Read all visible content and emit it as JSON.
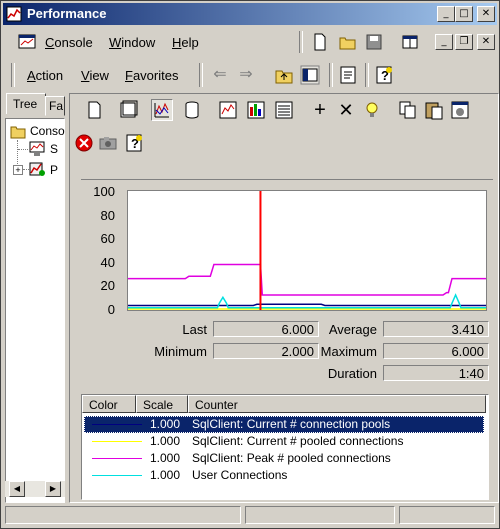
{
  "window": {
    "title": "Performance"
  },
  "menubar": {
    "items": [
      {
        "pre": "",
        "key": "C",
        "post": "onsole"
      },
      {
        "pre": "",
        "key": "W",
        "post": "indow"
      },
      {
        "pre": "",
        "key": "H",
        "post": "elp"
      }
    ]
  },
  "actionbar": {
    "items": [
      {
        "pre": "",
        "key": "A",
        "post": "ction"
      },
      {
        "pre": "",
        "key": "V",
        "post": "iew"
      },
      {
        "pre": "",
        "key": "F",
        "post": "avorites"
      }
    ]
  },
  "tabs": {
    "tree": "Tree",
    "favorites": "Fa"
  },
  "tree": {
    "root": "Conso",
    "child1": "S",
    "child2": "P"
  },
  "graph": {
    "y_ticks": [
      "100",
      "80",
      "60",
      "40",
      "20",
      "0"
    ],
    "ylim": [
      0,
      100
    ]
  },
  "stats": {
    "last_label": "Last",
    "last": "6.000",
    "average_label": "Average",
    "average": "3.410",
    "minimum_label": "Minimum",
    "minimum": "2.000",
    "maximum_label": "Maximum",
    "maximum": "6.000",
    "duration_label": "Duration",
    "duration": "1:40"
  },
  "legend": {
    "headers": {
      "color": "Color",
      "scale": "Scale",
      "counter": "Counter"
    },
    "rows": [
      {
        "color": "#000080",
        "scale": "1.000",
        "counter": "SqlClient: Current # connection pools",
        "selected": true
      },
      {
        "color": "#ffff00",
        "scale": "1.000",
        "counter": "SqlClient: Current # pooled connections",
        "selected": false
      },
      {
        "color": "#e000e0",
        "scale": "1.000",
        "counter": "SqlClient: Peak # pooled connections",
        "selected": false
      },
      {
        "color": "#00e0e0",
        "scale": "1.000",
        "counter": "User Connections",
        "selected": false
      }
    ]
  },
  "colors": {
    "accent": "#0a246a",
    "chrome": "#d4d0c8",
    "time_bar": "#ff0000"
  },
  "chart_data": {
    "type": "line",
    "ylim": [
      0,
      100
    ],
    "series": [
      {
        "name": "SqlClient: Current # connection pools",
        "color": "#000080",
        "x": [
          0,
          35,
          36,
          54,
          55,
          100
        ],
        "y": [
          3,
          3,
          4,
          4,
          3,
          3
        ]
      },
      {
        "name": "SqlClient: Current # pooled connections",
        "color": "#ffff00",
        "x": [
          0,
          100
        ],
        "y": [
          0,
          0
        ]
      },
      {
        "name": "SqlClient: Peak # pooled connections",
        "color": "#e000e0",
        "x": [
          0,
          16,
          17,
          23,
          24,
          37,
          37.5,
          88,
          89,
          89.5,
          90.5,
          100
        ],
        "y": [
          26,
          26,
          28,
          28,
          38,
          38,
          12,
          12,
          14,
          14,
          26,
          26
        ]
      },
      {
        "name": "User Connections",
        "color": "#00e0e0",
        "x": [
          0,
          25,
          25.5,
          26.5,
          27.5,
          28,
          37,
          37.5,
          90,
          90.5,
          91.5,
          92.5,
          93,
          100
        ],
        "y": [
          1,
          1,
          5,
          10,
          5,
          1,
          1,
          1,
          1,
          5,
          12,
          5,
          1,
          1
        ]
      }
    ],
    "current_time_x": 37
  }
}
